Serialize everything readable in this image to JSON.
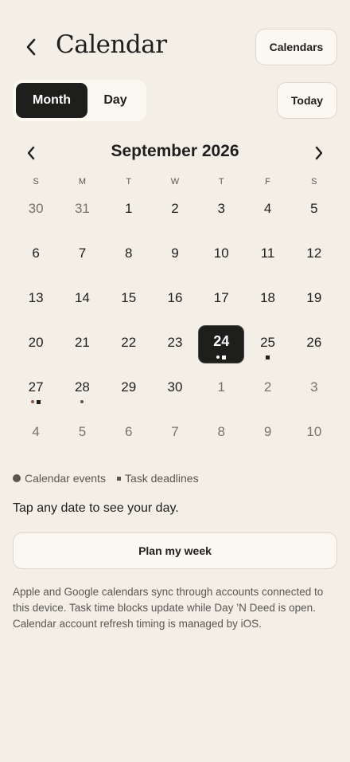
{
  "header": {
    "back_icon": "chevron-left-icon",
    "title": "Calendar",
    "calendars_label": "Calendars"
  },
  "view_toggle": {
    "month_label": "Month",
    "day_label": "Day",
    "selected": "Month"
  },
  "today_label": "Today",
  "month_nav": {
    "prev_icon": "chevron-left-icon",
    "next_icon": "chevron-right-icon",
    "title": "September 2026"
  },
  "weekdays": [
    "S",
    "M",
    "T",
    "W",
    "T",
    "F",
    "S"
  ],
  "weeks": [
    [
      {
        "d": "30",
        "other": true
      },
      {
        "d": "31",
        "other": true
      },
      {
        "d": "1"
      },
      {
        "d": "2"
      },
      {
        "d": "3"
      },
      {
        "d": "4"
      },
      {
        "d": "5"
      }
    ],
    [
      {
        "d": "6"
      },
      {
        "d": "7"
      },
      {
        "d": "8"
      },
      {
        "d": "9"
      },
      {
        "d": "10"
      },
      {
        "d": "11"
      },
      {
        "d": "12"
      }
    ],
    [
      {
        "d": "13"
      },
      {
        "d": "14"
      },
      {
        "d": "15"
      },
      {
        "d": "16"
      },
      {
        "d": "17"
      },
      {
        "d": "18"
      },
      {
        "d": "19"
      }
    ],
    [
      {
        "d": "20"
      },
      {
        "d": "21"
      },
      {
        "d": "22"
      },
      {
        "d": "23"
      },
      {
        "d": "24",
        "selected": true,
        "markers": [
          "event",
          "task"
        ]
      },
      {
        "d": "25",
        "markers": [
          "task"
        ]
      },
      {
        "d": "26"
      }
    ],
    [
      {
        "d": "27",
        "markers": [
          "event-brown",
          "task"
        ]
      },
      {
        "d": "28",
        "markers": [
          "event"
        ]
      },
      {
        "d": "29"
      },
      {
        "d": "30"
      },
      {
        "d": "1",
        "other": true
      },
      {
        "d": "2",
        "other": true
      },
      {
        "d": "3",
        "other": true
      }
    ],
    [
      {
        "d": "4",
        "other": true
      },
      {
        "d": "5",
        "other": true
      },
      {
        "d": "6",
        "other": true
      },
      {
        "d": "7",
        "other": true
      },
      {
        "d": "8",
        "other": true
      },
      {
        "d": "9",
        "other": true
      },
      {
        "d": "10",
        "other": true
      }
    ]
  ],
  "legend": {
    "events_label": "Calendar events",
    "tasks_label": "Task deadlines"
  },
  "hint": "Tap any date to see your day.",
  "plan_button_label": "Plan my week",
  "footnote": "Apple and Google calendars sync through accounts connected to this device. Task time blocks update while Day ’N Deed is open. Calendar account refresh timing is managed by iOS.",
  "colors": {
    "background": "#f3eee6",
    "surface": "#fbf8f2",
    "ink": "#1e1e1c",
    "muted": "#5a5752",
    "accent_dot": "#8a5a44"
  }
}
